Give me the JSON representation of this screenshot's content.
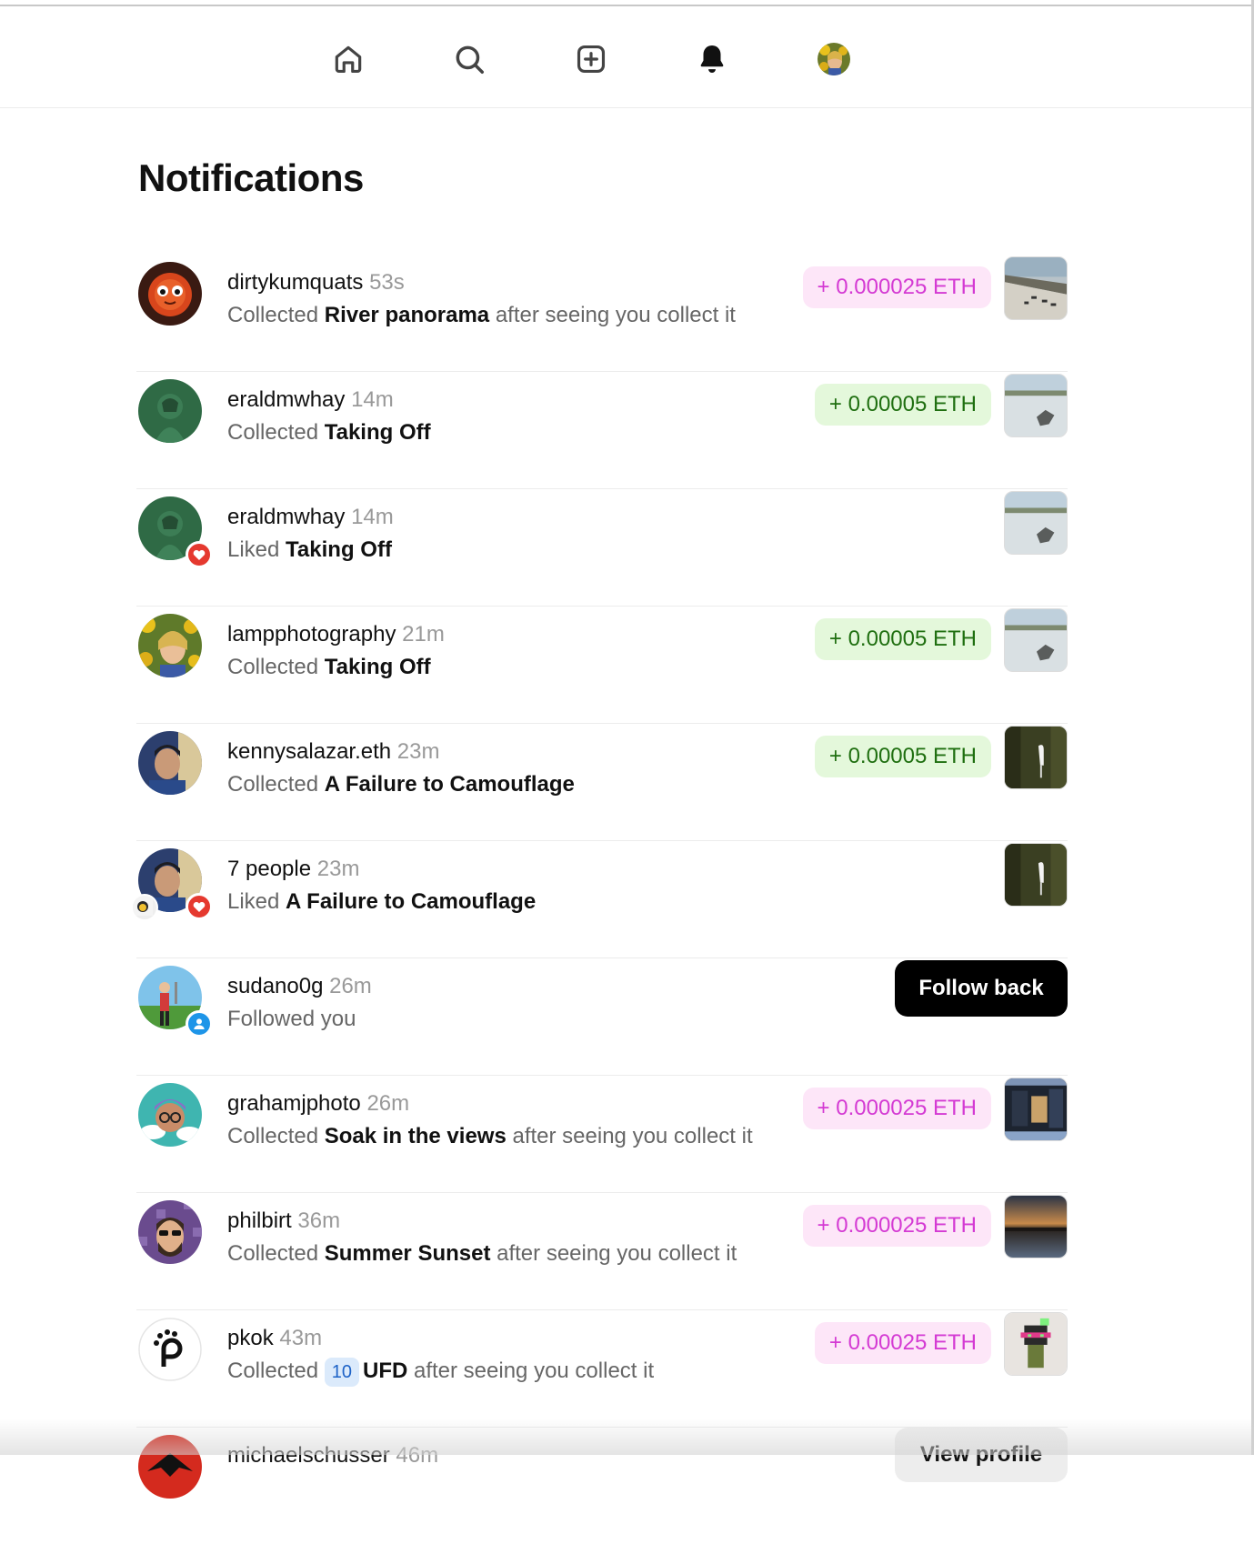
{
  "nav": {
    "items": [
      {
        "name": "home",
        "icon": "home-icon"
      },
      {
        "name": "search",
        "icon": "search-icon"
      },
      {
        "name": "create",
        "icon": "plus-square-icon"
      },
      {
        "name": "notifications",
        "icon": "bell-icon",
        "active": true
      },
      {
        "name": "profile",
        "icon": "avatar"
      }
    ]
  },
  "page": {
    "title": "Notifications"
  },
  "notifications": [
    {
      "user": "dirtykumquats",
      "time": "53s",
      "verb": "Collected",
      "item": "River panorama",
      "suffix": "after seeing you collect it",
      "amount": "+ 0.000025 ETH",
      "amount_style": "pink"
    },
    {
      "user": "eraldmwhay",
      "time": "14m",
      "verb": "Collected",
      "item": "Taking Off",
      "suffix": "",
      "amount": "+ 0.00005 ETH",
      "amount_style": "green"
    },
    {
      "user": "eraldmwhay",
      "time": "14m",
      "verb": "Liked",
      "item": "Taking Off",
      "suffix": "",
      "amount": "",
      "badge": "like"
    },
    {
      "user": "lampphotography",
      "time": "21m",
      "verb": "Collected",
      "item": "Taking Off",
      "suffix": "",
      "amount": "+ 0.00005 ETH",
      "amount_style": "green"
    },
    {
      "user": "kennysalazar.eth",
      "time": "23m",
      "verb": "Collected",
      "item": "A Failure to Camouflage",
      "suffix": "",
      "amount": "+ 0.00005 ETH",
      "amount_style": "green"
    },
    {
      "user": "7 people",
      "time": "23m",
      "verb": "Liked",
      "item": "A Failure to Camouflage",
      "suffix": "",
      "amount": "",
      "badge": "like"
    },
    {
      "user": "sudano0g",
      "time": "26m",
      "verb": "Followed you",
      "item": "",
      "suffix": "",
      "action": "Follow back",
      "badge": "follow"
    },
    {
      "user": "grahamjphoto",
      "time": "26m",
      "verb": "Collected",
      "item": "Soak in the views",
      "suffix": "after seeing you collect it",
      "amount": "+ 0.000025 ETH",
      "amount_style": "pink"
    },
    {
      "user": "philbirt",
      "time": "36m",
      "verb": "Collected",
      "item": "Summer Sunset",
      "suffix": "after seeing you collect it",
      "amount": "+ 0.000025 ETH",
      "amount_style": "pink"
    },
    {
      "user": "pkok",
      "time": "43m",
      "verb": "Collected",
      "count": "10",
      "item": "UFD",
      "suffix": "after seeing you collect it",
      "amount": "+ 0.00025 ETH",
      "amount_style": "pink"
    },
    {
      "user": "michaelschusser",
      "time": "46m",
      "action": "View profile"
    }
  ],
  "colors": {
    "pink_bg": "#fde6f8",
    "pink_text": "#d43ad3",
    "green_bg": "#e4f8db",
    "green_text": "#1f6f10",
    "like_badge": "#e5392f",
    "follow_badge": "#1e95e8"
  }
}
